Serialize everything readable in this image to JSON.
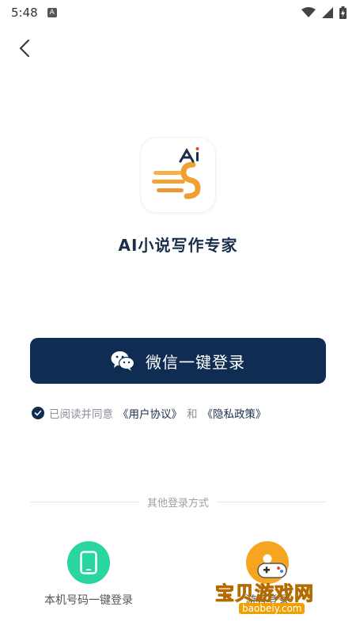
{
  "status": {
    "time": "5:48",
    "badge": "A"
  },
  "app": {
    "title": "AI小说写作专家",
    "logo_text": "Ai"
  },
  "buttons": {
    "wechat_login": "微信一键登录"
  },
  "agreement": {
    "prefix": "已阅读并同意",
    "user_agreement": "《用户协议》",
    "and": "和",
    "privacy_policy": "《隐私政策》"
  },
  "other": {
    "divider": "其他登录方式",
    "phone_login": "本机号码一键登录",
    "guest_login": "游客登录"
  },
  "watermark": {
    "text": "宝贝游戏网",
    "url": "baobeiy.com"
  },
  "colors": {
    "primary": "#0f2c52",
    "phone_icon_bg": "#2ad6a0",
    "guest_icon_bg": "#f7a520"
  }
}
